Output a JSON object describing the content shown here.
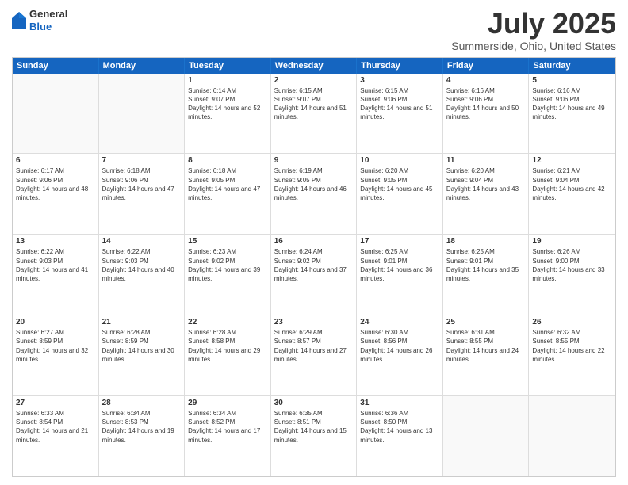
{
  "header": {
    "logo_general": "General",
    "logo_blue": "Blue",
    "title": "July 2025",
    "subtitle": "Summerside, Ohio, United States"
  },
  "calendar": {
    "days": [
      "Sunday",
      "Monday",
      "Tuesday",
      "Wednesday",
      "Thursday",
      "Friday",
      "Saturday"
    ],
    "rows": [
      [
        {
          "day": "",
          "content": ""
        },
        {
          "day": "",
          "content": ""
        },
        {
          "day": "1",
          "content": "Sunrise: 6:14 AM\nSunset: 9:07 PM\nDaylight: 14 hours and 52 minutes."
        },
        {
          "day": "2",
          "content": "Sunrise: 6:15 AM\nSunset: 9:07 PM\nDaylight: 14 hours and 51 minutes."
        },
        {
          "day": "3",
          "content": "Sunrise: 6:15 AM\nSunset: 9:06 PM\nDaylight: 14 hours and 51 minutes."
        },
        {
          "day": "4",
          "content": "Sunrise: 6:16 AM\nSunset: 9:06 PM\nDaylight: 14 hours and 50 minutes."
        },
        {
          "day": "5",
          "content": "Sunrise: 6:16 AM\nSunset: 9:06 PM\nDaylight: 14 hours and 49 minutes."
        }
      ],
      [
        {
          "day": "6",
          "content": "Sunrise: 6:17 AM\nSunset: 9:06 PM\nDaylight: 14 hours and 48 minutes."
        },
        {
          "day": "7",
          "content": "Sunrise: 6:18 AM\nSunset: 9:06 PM\nDaylight: 14 hours and 47 minutes."
        },
        {
          "day": "8",
          "content": "Sunrise: 6:18 AM\nSunset: 9:05 PM\nDaylight: 14 hours and 47 minutes."
        },
        {
          "day": "9",
          "content": "Sunrise: 6:19 AM\nSunset: 9:05 PM\nDaylight: 14 hours and 46 minutes."
        },
        {
          "day": "10",
          "content": "Sunrise: 6:20 AM\nSunset: 9:05 PM\nDaylight: 14 hours and 45 minutes."
        },
        {
          "day": "11",
          "content": "Sunrise: 6:20 AM\nSunset: 9:04 PM\nDaylight: 14 hours and 43 minutes."
        },
        {
          "day": "12",
          "content": "Sunrise: 6:21 AM\nSunset: 9:04 PM\nDaylight: 14 hours and 42 minutes."
        }
      ],
      [
        {
          "day": "13",
          "content": "Sunrise: 6:22 AM\nSunset: 9:03 PM\nDaylight: 14 hours and 41 minutes."
        },
        {
          "day": "14",
          "content": "Sunrise: 6:22 AM\nSunset: 9:03 PM\nDaylight: 14 hours and 40 minutes."
        },
        {
          "day": "15",
          "content": "Sunrise: 6:23 AM\nSunset: 9:02 PM\nDaylight: 14 hours and 39 minutes."
        },
        {
          "day": "16",
          "content": "Sunrise: 6:24 AM\nSunset: 9:02 PM\nDaylight: 14 hours and 37 minutes."
        },
        {
          "day": "17",
          "content": "Sunrise: 6:25 AM\nSunset: 9:01 PM\nDaylight: 14 hours and 36 minutes."
        },
        {
          "day": "18",
          "content": "Sunrise: 6:25 AM\nSunset: 9:01 PM\nDaylight: 14 hours and 35 minutes."
        },
        {
          "day": "19",
          "content": "Sunrise: 6:26 AM\nSunset: 9:00 PM\nDaylight: 14 hours and 33 minutes."
        }
      ],
      [
        {
          "day": "20",
          "content": "Sunrise: 6:27 AM\nSunset: 8:59 PM\nDaylight: 14 hours and 32 minutes."
        },
        {
          "day": "21",
          "content": "Sunrise: 6:28 AM\nSunset: 8:59 PM\nDaylight: 14 hours and 30 minutes."
        },
        {
          "day": "22",
          "content": "Sunrise: 6:28 AM\nSunset: 8:58 PM\nDaylight: 14 hours and 29 minutes."
        },
        {
          "day": "23",
          "content": "Sunrise: 6:29 AM\nSunset: 8:57 PM\nDaylight: 14 hours and 27 minutes."
        },
        {
          "day": "24",
          "content": "Sunrise: 6:30 AM\nSunset: 8:56 PM\nDaylight: 14 hours and 26 minutes."
        },
        {
          "day": "25",
          "content": "Sunrise: 6:31 AM\nSunset: 8:55 PM\nDaylight: 14 hours and 24 minutes."
        },
        {
          "day": "26",
          "content": "Sunrise: 6:32 AM\nSunset: 8:55 PM\nDaylight: 14 hours and 22 minutes."
        }
      ],
      [
        {
          "day": "27",
          "content": "Sunrise: 6:33 AM\nSunset: 8:54 PM\nDaylight: 14 hours and 21 minutes."
        },
        {
          "day": "28",
          "content": "Sunrise: 6:34 AM\nSunset: 8:53 PM\nDaylight: 14 hours and 19 minutes."
        },
        {
          "day": "29",
          "content": "Sunrise: 6:34 AM\nSunset: 8:52 PM\nDaylight: 14 hours and 17 minutes."
        },
        {
          "day": "30",
          "content": "Sunrise: 6:35 AM\nSunset: 8:51 PM\nDaylight: 14 hours and 15 minutes."
        },
        {
          "day": "31",
          "content": "Sunrise: 6:36 AM\nSunset: 8:50 PM\nDaylight: 14 hours and 13 minutes."
        },
        {
          "day": "",
          "content": ""
        },
        {
          "day": "",
          "content": ""
        }
      ]
    ]
  }
}
